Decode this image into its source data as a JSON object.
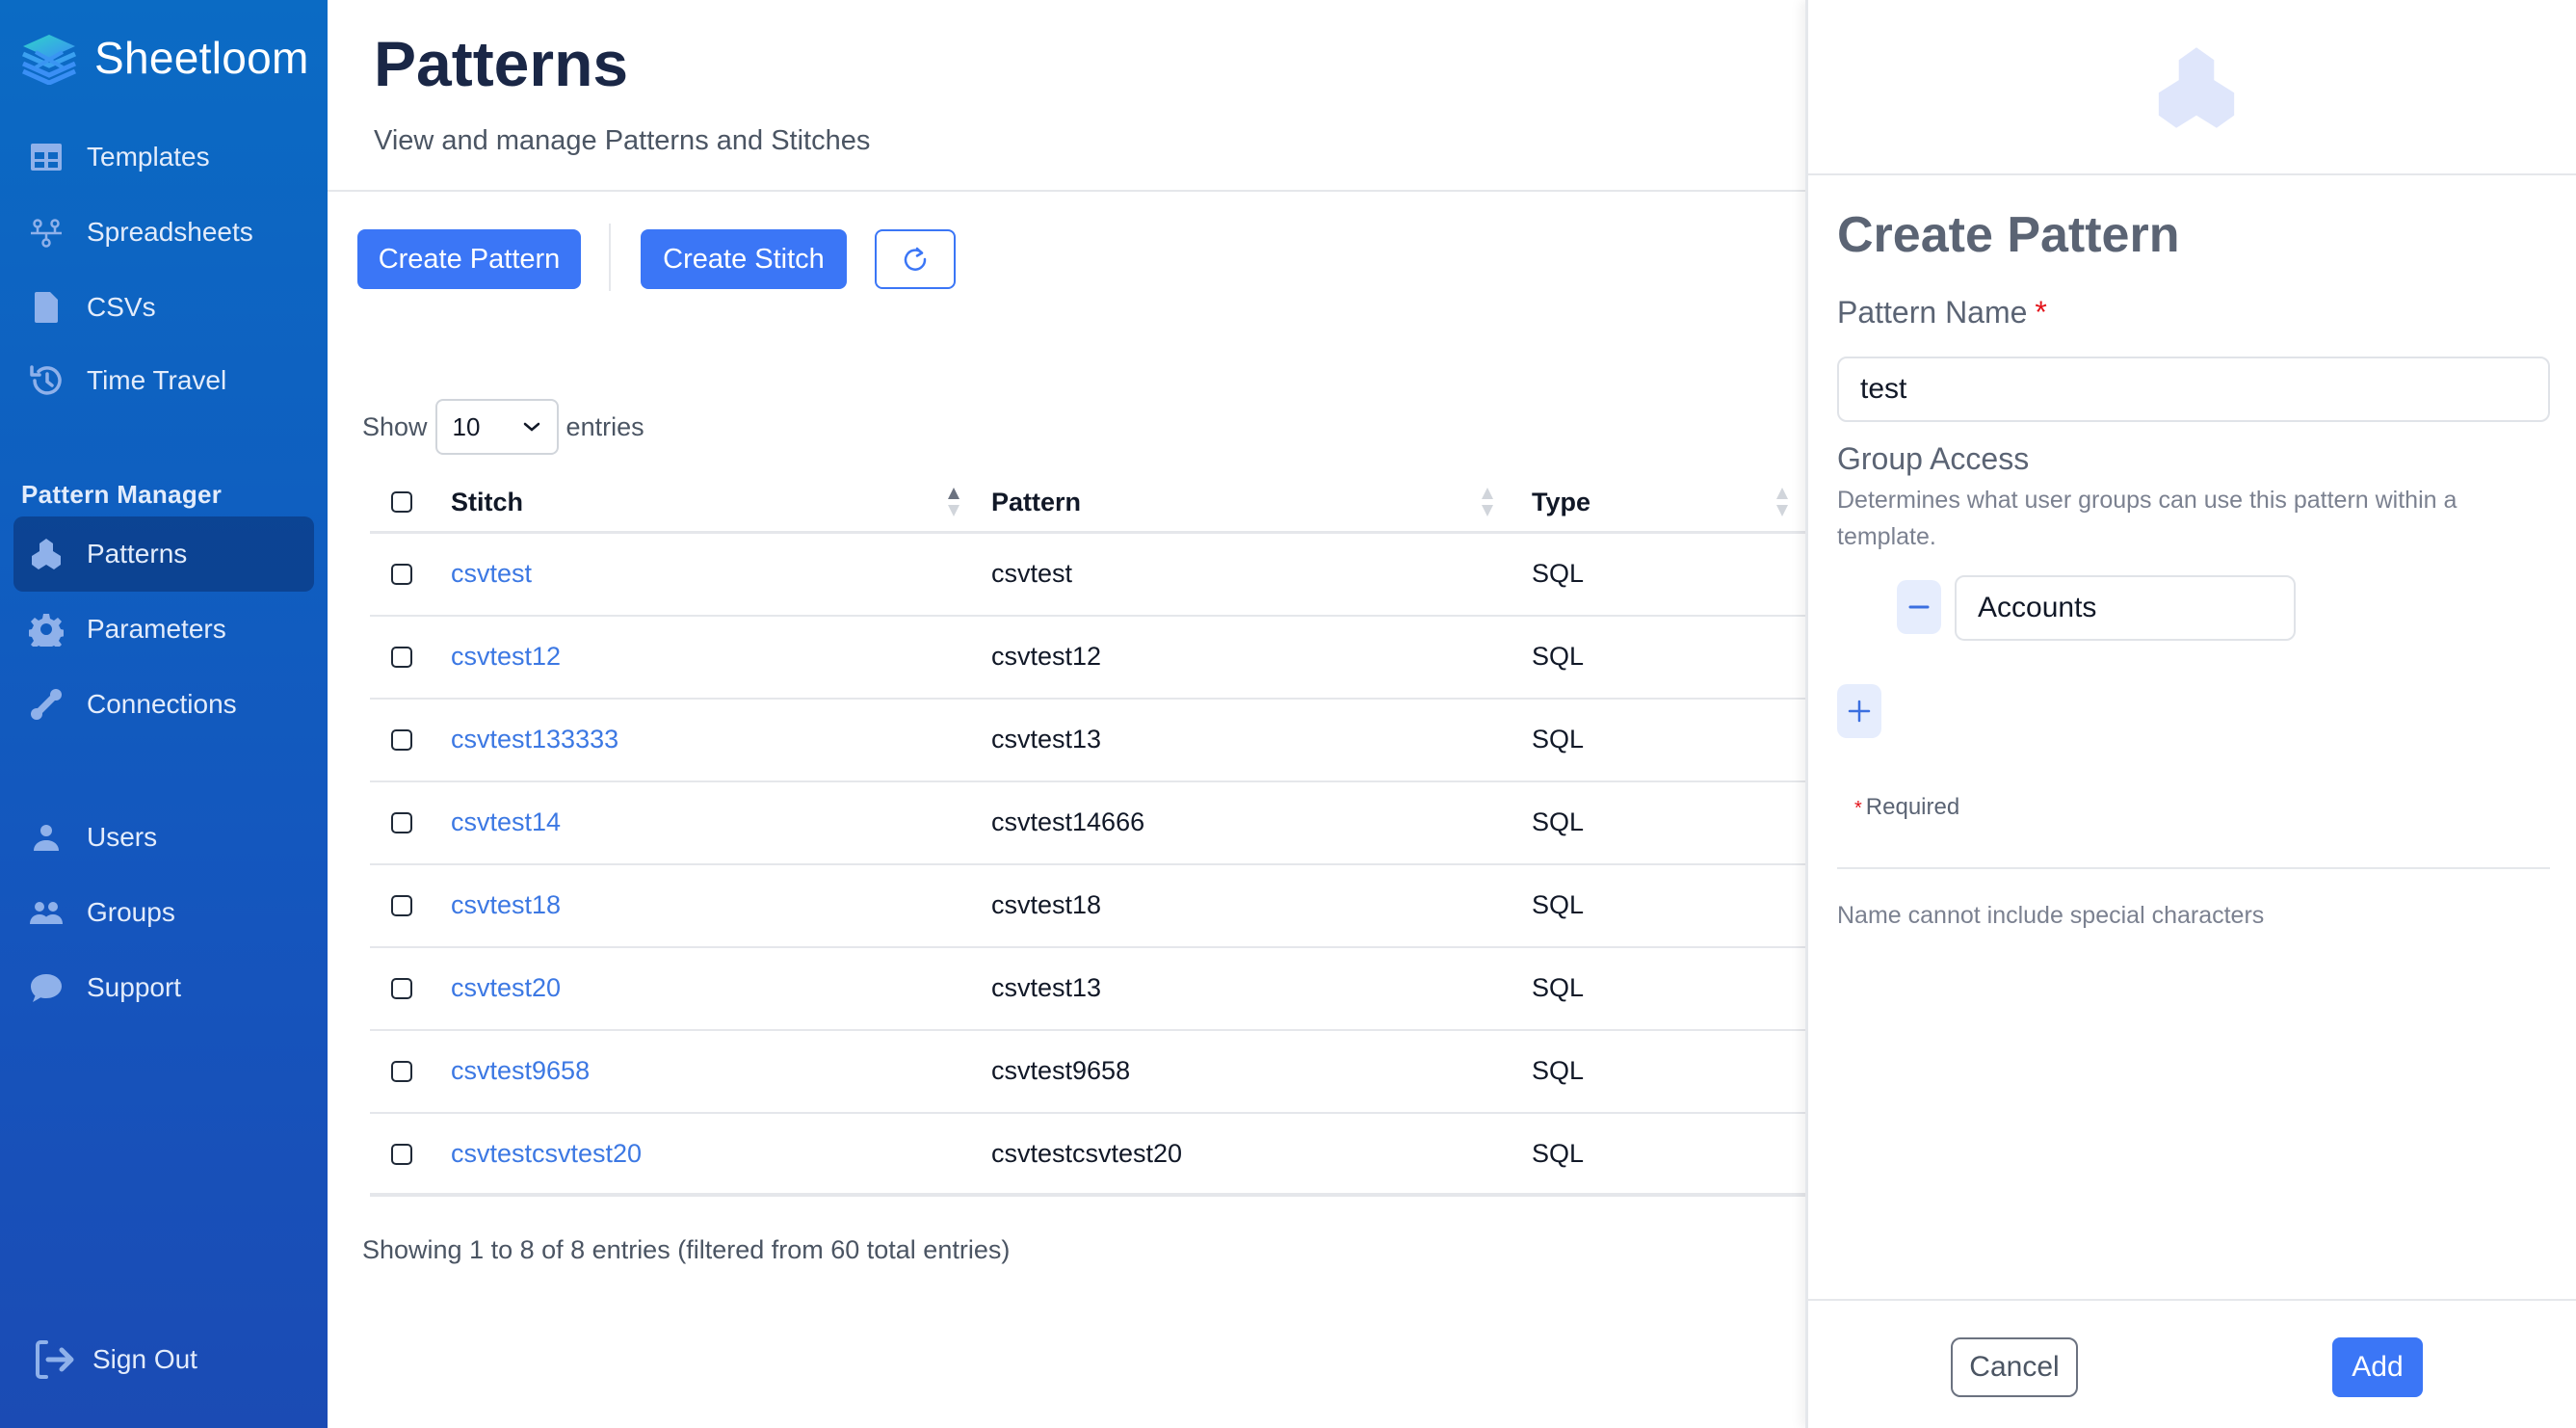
{
  "app": {
    "name": "Sheetloom"
  },
  "sidebar": {
    "items_top": [
      {
        "label": "Templates",
        "icon": "table-icon"
      },
      {
        "label": "Spreadsheets",
        "icon": "network-icon"
      },
      {
        "label": "CSVs",
        "icon": "file-icon"
      },
      {
        "label": "Time Travel",
        "icon": "history-icon"
      }
    ],
    "section_title": "Pattern Manager",
    "items_pattern": [
      {
        "label": "Patterns",
        "icon": "cubes-icon",
        "active": true
      },
      {
        "label": "Parameters",
        "icon": "gear-icon"
      },
      {
        "label": "Connections",
        "icon": "link-icon"
      }
    ],
    "items_bottom": [
      {
        "label": "Users",
        "icon": "user-icon"
      },
      {
        "label": "Groups",
        "icon": "users-icon"
      },
      {
        "label": "Support",
        "icon": "chat-icon"
      }
    ],
    "sign_out": "Sign Out"
  },
  "header": {
    "title": "Patterns",
    "subtitle": "View and manage Patterns and Stitches"
  },
  "toolbar": {
    "create_pattern": "Create Pattern",
    "create_stitch": "Create Stitch",
    "refresh_icon": "refresh-icon"
  },
  "table": {
    "show_label": "Show",
    "page_size": "10",
    "entries_label": "entries",
    "columns": [
      "Stitch",
      "Pattern",
      "Type"
    ],
    "rows": [
      {
        "stitch": "csvtest",
        "pattern": "csvtest",
        "type": "SQL"
      },
      {
        "stitch": "csvtest12",
        "pattern": "csvtest12",
        "type": "SQL"
      },
      {
        "stitch": "csvtest133333",
        "pattern": "csvtest13",
        "type": "SQL"
      },
      {
        "stitch": "csvtest14",
        "pattern": "csvtest14666",
        "type": "SQL"
      },
      {
        "stitch": "csvtest18",
        "pattern": "csvtest18",
        "type": "SQL"
      },
      {
        "stitch": "csvtest20",
        "pattern": "csvtest13",
        "type": "SQL"
      },
      {
        "stitch": "csvtest9658",
        "pattern": "csvtest9658",
        "type": "SQL"
      },
      {
        "stitch": "csvtestcsvtest20",
        "pattern": "csvtestcsvtest20",
        "type": "SQL"
      }
    ],
    "info": "Showing 1 to 8 of 8 entries (filtered from 60 total entries)"
  },
  "panel": {
    "title": "Create Pattern",
    "name_label": "Pattern Name",
    "required_star": "*",
    "name_value": "test",
    "group_label": "Group Access",
    "group_help": "Determines what user groups can use this pattern within a template.",
    "groups": [
      "Accounts"
    ],
    "required_note": "Required",
    "name_hint": "Name cannot include special characters",
    "cancel": "Cancel",
    "add": "Add"
  },
  "colors": {
    "primary": "#3b76f6",
    "link": "#3c78e3",
    "required": "#e3141b",
    "sidebar_top": "#0b6bc4",
    "sidebar_bottom": "#1b4bb4"
  }
}
